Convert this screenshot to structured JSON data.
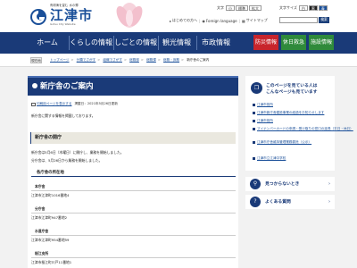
{
  "header": {
    "logo_sub": "有明海を望む 水の郷",
    "logo_main": "江津市",
    "logo_en": "Gotsu City Website",
    "util": {
      "font_size_label": "文字",
      "font_size_small": "小",
      "font_size_std": "標準",
      "font_size_large": "拡大",
      "bg_color_label": "文字サイズ",
      "bg_white": "白",
      "bg_black": "黒",
      "bg_blue": "青",
      "beginners": "はじめての方へ",
      "foreign": "Foreign language",
      "sitemap": "サイトマップ"
    },
    "search_placeholder": "",
    "search_button": "検索"
  },
  "nav": {
    "items": [
      "ホーム",
      "くらしの情報",
      "しごとの情報",
      "観光情報",
      "市政情報"
    ],
    "buttons": [
      {
        "label": "防災情報",
        "color": "#c8252c"
      },
      {
        "label": "休日救急",
        "color": "#2f8a3b"
      },
      {
        "label": "施設情報",
        "color": "#2f8a3b"
      }
    ]
  },
  "breadcrumb": {
    "home_label": "現在地",
    "items": [
      "トップページ",
      "分類でさがす",
      "組織でさがす",
      "総務部",
      "総務課",
      "総務・庶務",
      "新庁舎のご案内"
    ]
  },
  "main": {
    "title": "新庁舎のご案内",
    "print_label": "印刷用ページを表示する",
    "updated": "掲載日：2021年5月26日更新",
    "intro": "新庁舎に関する情報を掲載しております。",
    "section1_title": "新庁舎の開庁",
    "section1_text1": "新庁舎は5月6日（木曜日）に開庁し、業務を開始しました。",
    "section1_text2": "分庁舎は、5月26日から業務を開始しました。",
    "section2_title": "各庁舎の所在地",
    "locations": [
      {
        "name": "本庁舎",
        "address": "江津市江津町1016番地4"
      },
      {
        "name": "分庁舎",
        "address": "江津市江津町947番地2"
      },
      {
        "name": "水道庁舎",
        "address": "江津市江津町954番地59"
      },
      {
        "name": "桜江支所",
        "address": "江津市桜江町川戸11番地1"
      }
    ]
  },
  "side": {
    "q_line1": "このページを見ている人は",
    "q_line2": "こんなページも見ています",
    "links": [
      "江津市役所",
      "江津市新庁舎建設事業の経過をお知らせします",
      "江津市役所",
      "マイナンバーカードの申請・受け取りの窓口の延長（平日・休日）",
      "江津市庁舎維持管理業務委託（公示）",
      "江津市立江津中学校"
    ],
    "card1": "見つからないとき",
    "card2": "よくある質問"
  }
}
